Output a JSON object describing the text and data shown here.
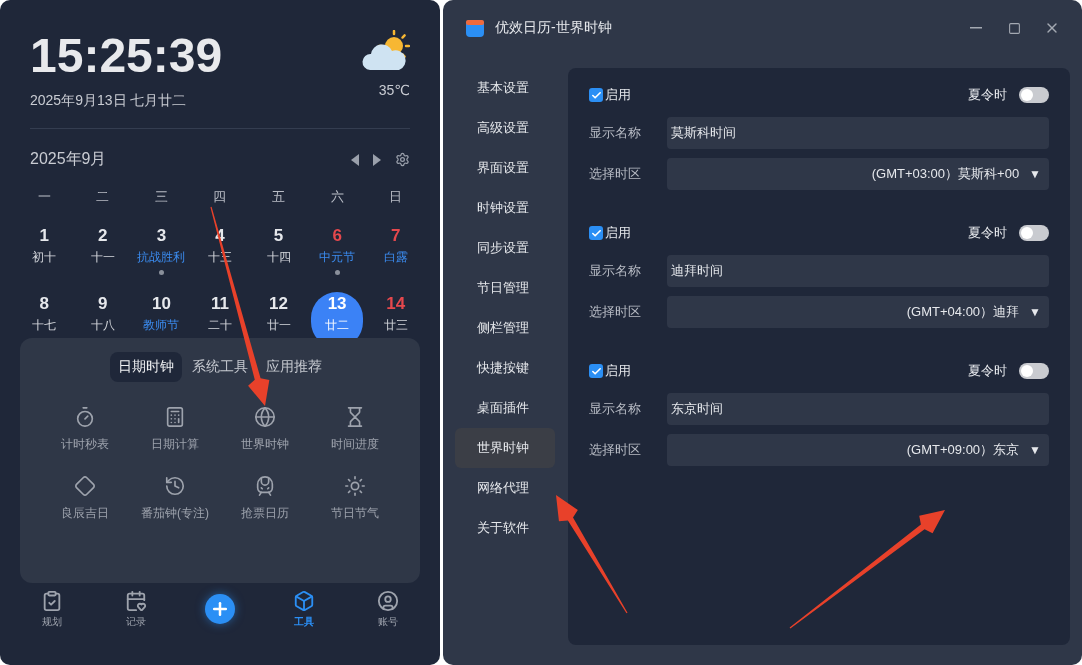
{
  "widget": {
    "time": "15:25:39",
    "date": "2025年9月13日 七月廿二",
    "temperature": "35℃",
    "calendar": {
      "month": "2025年9月",
      "weekdays": [
        "一",
        "二",
        "三",
        "四",
        "五",
        "六",
        "日"
      ],
      "days": [
        {
          "day": "1",
          "lunar": "初十",
          "weekend": false,
          "festival": false,
          "dot": false,
          "selected": false
        },
        {
          "day": "2",
          "lunar": "十一",
          "weekend": false,
          "festival": false,
          "dot": false,
          "selected": false
        },
        {
          "day": "3",
          "lunar": "抗战胜利",
          "weekend": false,
          "festival": true,
          "dot": true,
          "selected": false
        },
        {
          "day": "4",
          "lunar": "十三",
          "weekend": false,
          "festival": false,
          "dot": false,
          "selected": false
        },
        {
          "day": "5",
          "lunar": "十四",
          "weekend": false,
          "festival": false,
          "dot": false,
          "selected": false
        },
        {
          "day": "6",
          "lunar": "中元节",
          "weekend": true,
          "festival": true,
          "dot": true,
          "selected": false
        },
        {
          "day": "7",
          "lunar": "白露",
          "weekend": true,
          "festival": true,
          "dot": false,
          "selected": false
        },
        {
          "day": "8",
          "lunar": "十七",
          "weekend": false,
          "festival": false,
          "dot": false,
          "selected": false
        },
        {
          "day": "9",
          "lunar": "十八",
          "weekend": false,
          "festival": false,
          "dot": false,
          "selected": false
        },
        {
          "day": "10",
          "lunar": "教师节",
          "weekend": false,
          "festival": true,
          "dot": false,
          "selected": false
        },
        {
          "day": "11",
          "lunar": "二十",
          "weekend": false,
          "festival": false,
          "dot": false,
          "selected": false
        },
        {
          "day": "12",
          "lunar": "廿一",
          "weekend": false,
          "festival": false,
          "dot": false,
          "selected": false
        },
        {
          "day": "13",
          "lunar": "廿二",
          "weekend": false,
          "festival": false,
          "dot": false,
          "selected": true
        },
        {
          "day": "14",
          "lunar": "廿三",
          "weekend": true,
          "festival": false,
          "dot": false,
          "selected": false
        }
      ]
    },
    "tools": {
      "tabs": [
        {
          "label": "日期时钟",
          "selected": true
        },
        {
          "label": "系统工具",
          "selected": false
        },
        {
          "label": "应用推荐",
          "selected": false
        }
      ],
      "items": [
        "计时秒表",
        "日期计算",
        "世界时钟",
        "时间进度",
        "良辰吉日",
        "番茄钟(专注)",
        "抢票日历",
        "节日节气"
      ]
    },
    "nav": [
      {
        "kind": "tab",
        "label": "规划",
        "selected": false
      },
      {
        "kind": "tab",
        "label": "记录",
        "selected": false
      },
      {
        "kind": "add"
      },
      {
        "kind": "tab",
        "label": "工具",
        "selected": true
      },
      {
        "kind": "tab",
        "label": "账号",
        "selected": false
      }
    ]
  },
  "window": {
    "title": "优效日历-世界时钟",
    "sidebar": [
      {
        "label": "基本设置",
        "selected": false
      },
      {
        "label": "高级设置",
        "selected": false
      },
      {
        "label": "界面设置",
        "selected": false
      },
      {
        "label": "时钟设置",
        "selected": false
      },
      {
        "label": "同步设置",
        "selected": false
      },
      {
        "label": "节日管理",
        "selected": false
      },
      {
        "label": "侧栏管理",
        "selected": false
      },
      {
        "label": "快捷按键",
        "selected": false
      },
      {
        "label": "桌面插件",
        "selected": false
      },
      {
        "label": "世界时钟",
        "selected": true
      },
      {
        "label": "网络代理",
        "selected": false
      },
      {
        "label": "关于软件",
        "selected": false
      }
    ],
    "clocks": [
      {
        "enable_label": "启用",
        "enabled": true,
        "dst_label": "夏令时",
        "dst": false,
        "name_label": "显示名称",
        "name": "莫斯科时间",
        "zone_label": "选择时区",
        "zone": "(GMT+03:00）莫斯科+00",
        "caret": "▼"
      },
      {
        "enable_label": "启用",
        "enabled": true,
        "dst_label": "夏令时",
        "dst": false,
        "name_label": "显示名称",
        "name": "迪拜时间",
        "zone_label": "选择时区",
        "zone": "(GMT+04:00）迪拜",
        "caret": "▼"
      },
      {
        "enable_label": "启用",
        "enabled": true,
        "dst_label": "夏令时",
        "dst": false,
        "name_label": "显示名称",
        "name": "东京时间",
        "zone_label": "选择时区",
        "zone": "(GMT+09:00）东京",
        "caret": "▼"
      }
    ]
  }
}
